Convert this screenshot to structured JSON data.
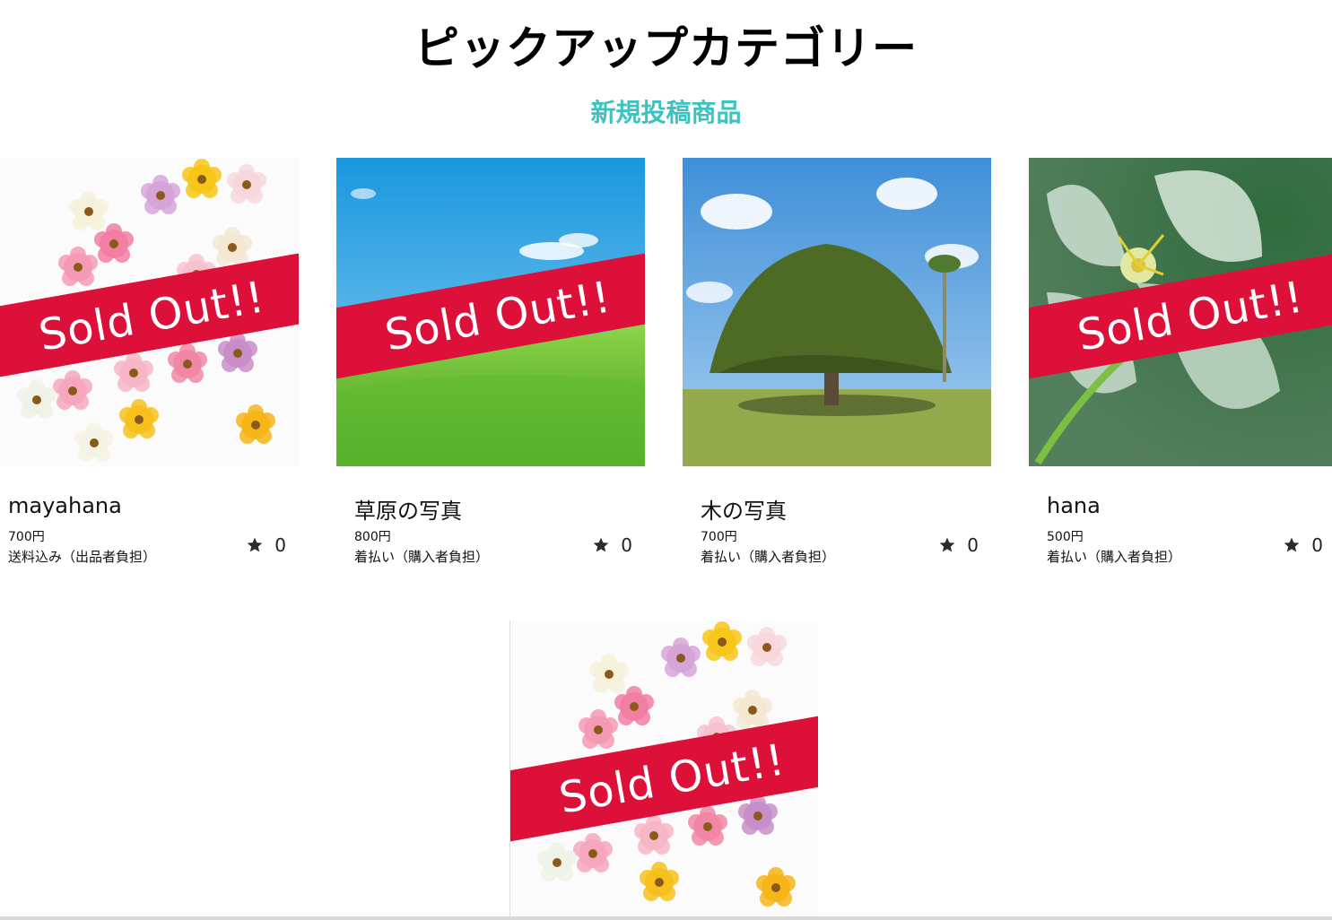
{
  "header": {
    "title": "ピックアップカテゴリー",
    "subtitle": "新規投稿商品"
  },
  "colors": {
    "accent": "#3cc3c0",
    "sold_ribbon": "#dc1039"
  },
  "sold_label": "Sold Out!!",
  "items": [
    {
      "name": "mayahana",
      "price": "700円",
      "shipping": "送料込み（出品者負担）",
      "likes": "0",
      "image": "flowers-image"
    },
    {
      "name": "草原の写真",
      "price": "800円",
      "shipping": "着払い（購入者負担）",
      "likes": "0",
      "image": "meadow-image"
    },
    {
      "name": "木の写真",
      "price": "700円",
      "shipping": "着払い（購入者負担）",
      "likes": "0",
      "image": "tree-image"
    },
    {
      "name": "hana",
      "price": "500円",
      "shipping": "着払い（購入者負担）",
      "likes": "0",
      "image": "clear-flower-image"
    },
    {
      "name": "",
      "price": "",
      "shipping": "",
      "likes": "",
      "image": "flowers-image"
    }
  ]
}
